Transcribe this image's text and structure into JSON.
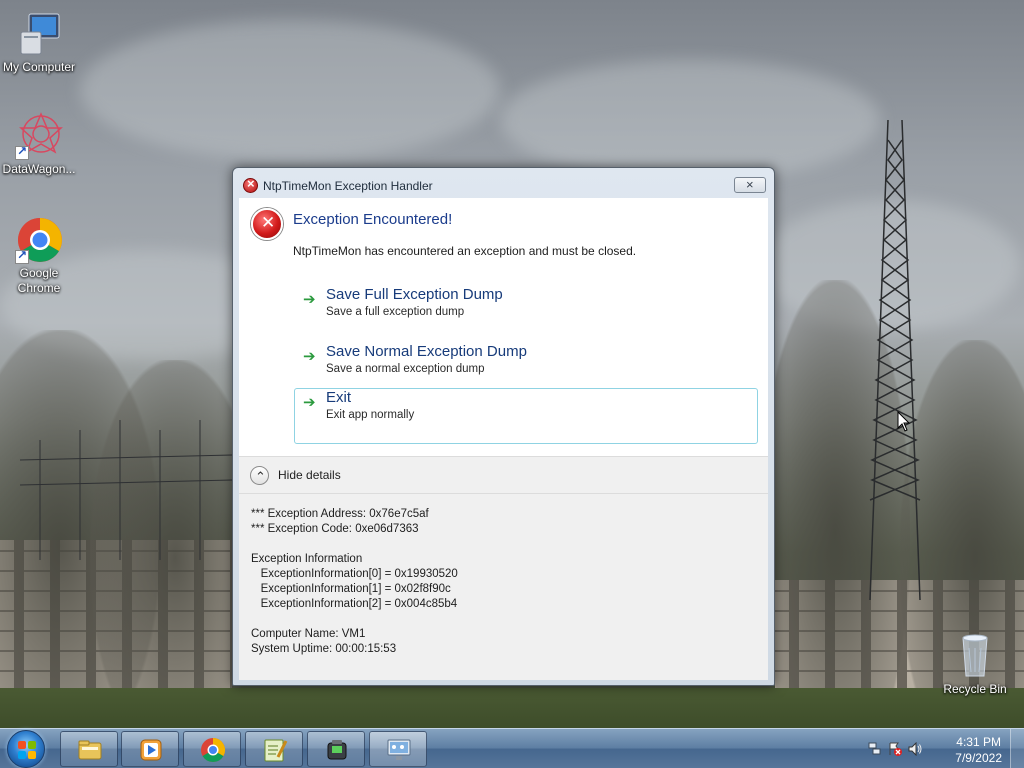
{
  "desktop": {
    "icons": [
      {
        "label": "My Computer",
        "icon": "computer-icon"
      },
      {
        "label": "DataWagon...",
        "icon": "datawagon-icon"
      },
      {
        "label": "Google\nChrome",
        "icon": "chrome-icon"
      }
    ],
    "recycle_bin": {
      "label": "Recycle Bin",
      "icon": "recycle-bin-icon"
    }
  },
  "dialog": {
    "title": "NtpTimeMon Exception Handler",
    "close_label": "×",
    "main_instruction": "Exception Encountered!",
    "content": "NtpTimeMon has encountered an exception and must be closed.",
    "commands": [
      {
        "title": "Save Full Exception Dump",
        "description": "Save a full exception dump",
        "focused": false
      },
      {
        "title": "Save Normal Exception Dump",
        "description": "Save a normal exception dump",
        "focused": false
      },
      {
        "title": "Exit",
        "description": "Exit app normally",
        "focused": true
      }
    ],
    "details_toggle": "Hide details",
    "details": [
      "*** Exception Address: 0x76e7c5af",
      "*** Exception Code: 0xe06d7363",
      "",
      "Exception Information",
      "   ExceptionInformation[0] = 0x19930520",
      "   ExceptionInformation[1] = 0x02f8f90c",
      "   ExceptionInformation[2] = 0x004c85b4",
      "",
      "Computer Name: VM1",
      "System Uptime: 00:00:15:53"
    ]
  },
  "taskbar": {
    "start_icon": "windows-start-icon",
    "pinned": [
      {
        "name": "explorer",
        "icon": "folder-icon"
      },
      {
        "name": "media-player",
        "icon": "media-player-icon"
      },
      {
        "name": "chrome",
        "icon": "chrome-icon"
      },
      {
        "name": "notepad-plus-plus",
        "icon": "notepad-plus-plus-icon"
      },
      {
        "name": "app",
        "icon": "app-device-icon"
      },
      {
        "name": "ntptimemon",
        "icon": "network-monitor-icon"
      }
    ],
    "tray_icons": [
      "network-icon",
      "action-center-icon",
      "volume-icon"
    ],
    "time": "4:31 PM",
    "date": "7/9/2022"
  },
  "colors": {
    "dialog_title_blue": "#1b3c8c",
    "command_title_blue": "#173b7a",
    "command_arrow_green": "#2b9a3e",
    "focus_border": "#8fd3e3",
    "error_red": "#d21b1b"
  }
}
